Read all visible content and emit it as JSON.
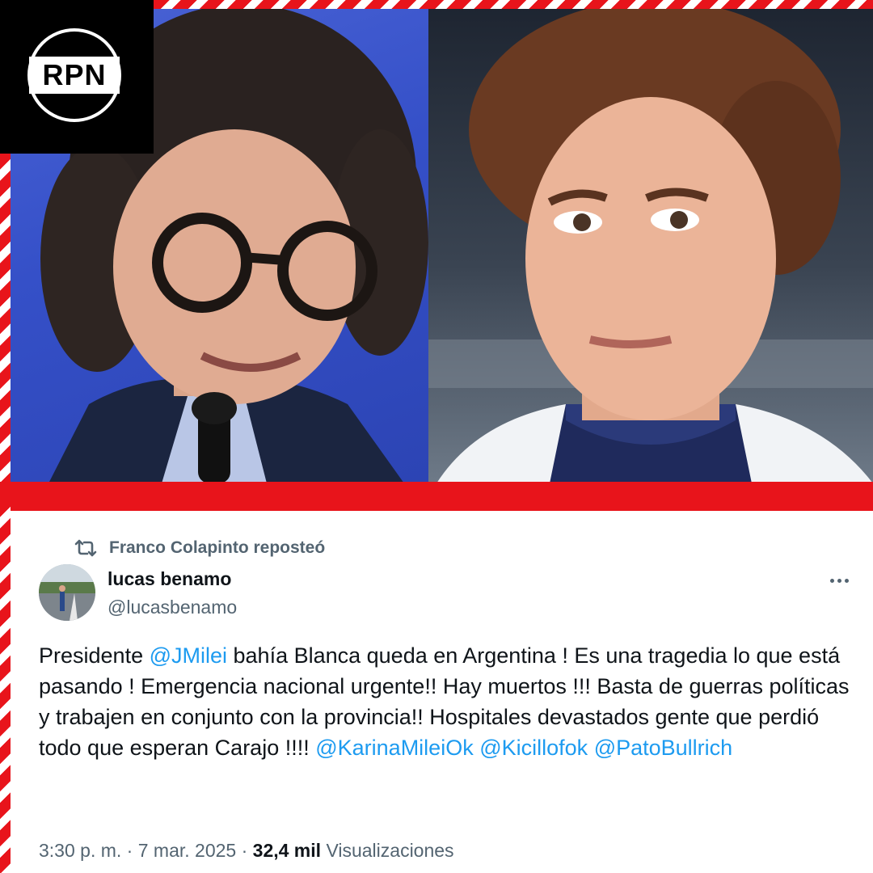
{
  "brand": {
    "logo_text": "RPN",
    "accent": "#e8141b"
  },
  "tweet": {
    "repost_label": "Franco Colapinto reposteó",
    "author_name": "lucas benamo",
    "author_handle": "@lucasbenamo",
    "text_parts": [
      {
        "type": "text",
        "value": "Presidente "
      },
      {
        "type": "mention",
        "value": "@JMilei"
      },
      {
        "type": "text",
        "value": " bahía Blanca queda en Argentina ! Es una tragedia lo que está pasando ! Emergencia nacional urgente!! Hay muertos  !!! Basta de guerras políticas y trabajen en conjunto con la provincia!! Hospitales devastados gente que perdió todo que esperan Carajo !!!! "
      },
      {
        "type": "mention",
        "value": "@KarinaMileiOk"
      },
      {
        "type": "text",
        "value": " "
      },
      {
        "type": "mention",
        "value": "@Kicillofok"
      },
      {
        "type": "text",
        "value": " "
      },
      {
        "type": "mention",
        "value": "@PatoBullrich"
      }
    ],
    "time": "3:30 p. m.",
    "date": "7 mar. 2025",
    "views_count": "32,4 mil",
    "views_label": "Visualizaciones",
    "separator": "·",
    "mention_color": "#1d9bf0"
  },
  "icons": {
    "repost": "repost-icon",
    "more": "more-options-icon"
  }
}
